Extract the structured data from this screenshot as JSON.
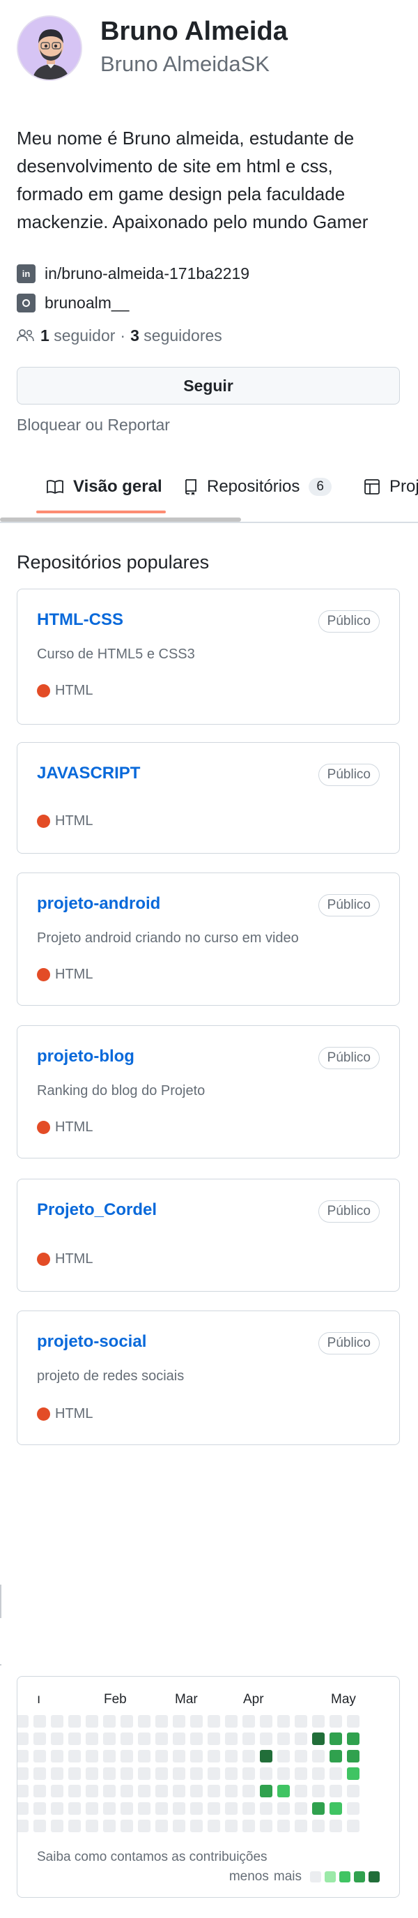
{
  "profile": {
    "name": "Bruno Almeida",
    "login": "Bruno AlmeidaSK",
    "bio_lines": [
      "Meu nome é Bruno almeida, estudante de",
      "desenvolvimento de site em html e css,",
      "formado em game design pela faculdade",
      "mackenzie. Apaixonado pelo mundo Gamer"
    ],
    "linkedin_icon": "in",
    "linkedin": "in/bruno-almeida-171ba2219",
    "instagram": "brunoalm__"
  },
  "followers": {
    "followers_count": "1",
    "followers_label": "seguidor",
    "separator": "·",
    "following_count": "3",
    "following_label": "seguidores"
  },
  "actions": {
    "follow_label": "Seguir",
    "block_label": "Bloquear ou Reportar"
  },
  "tabs": [
    {
      "label": "Visão geral",
      "icon": "book-icon"
    },
    {
      "label": "Repositórios",
      "count": "6",
      "icon": "repo-icon"
    },
    {
      "label": "Projetos",
      "icon": "table-icon"
    }
  ],
  "popular": {
    "title": "Repositórios populares",
    "repos": [
      {
        "name": "HTML-CSS",
        "visibility": "Público",
        "description": "Curso de HTML5 e CSS3",
        "language": "HTML"
      },
      {
        "name": "JAVASCRIPT",
        "visibility": "Público",
        "description": "",
        "language": "HTML"
      },
      {
        "name": "projeto-android",
        "visibility": "Público",
        "description": "Projeto android criando no curso em video",
        "language": "HTML"
      },
      {
        "name": "projeto-blog",
        "visibility": "Público",
        "description": "Ranking do blog do Projeto",
        "language": "HTML"
      },
      {
        "name": "Projeto_Cordel",
        "visibility": "Público",
        "description": "",
        "language": "HTML"
      },
      {
        "name": "projeto-social",
        "visibility": "Público",
        "description": "projeto de redes sociais",
        "language": "HTML"
      }
    ]
  },
  "contributions": {
    "months": [
      "Feb",
      "Mar",
      "Apr",
      "May"
    ],
    "link_label": "Saiba como contamos as contribuições",
    "legend_less": "menos",
    "legend_more": "mais",
    "legend_colors": [
      "#ebedf0",
      "#9be9a8",
      "#40c463",
      "#30a14e",
      "#216e39"
    ],
    "levels": [
      [
        0,
        0,
        0,
        0,
        0,
        0,
        0
      ],
      [
        0,
        0,
        0,
        0,
        0,
        0,
        0
      ],
      [
        0,
        0,
        0,
        0,
        0,
        0,
        0
      ],
      [
        0,
        0,
        0,
        0,
        0,
        0,
        0
      ],
      [
        0,
        0,
        0,
        0,
        0,
        0,
        0
      ],
      [
        0,
        0,
        0,
        0,
        0,
        0,
        0
      ],
      [
        0,
        0,
        0,
        0,
        0,
        0,
        0
      ],
      [
        0,
        0,
        0,
        0,
        0,
        0,
        0
      ],
      [
        0,
        0,
        0,
        0,
        0,
        0,
        0
      ],
      [
        0,
        0,
        0,
        0,
        0,
        0,
        0
      ],
      [
        0,
        0,
        0,
        0,
        0,
        0,
        0
      ],
      [
        0,
        0,
        0,
        0,
        0,
        0,
        0
      ],
      [
        0,
        0,
        0,
        0,
        0,
        0,
        0
      ],
      [
        0,
        0,
        0,
        0,
        0,
        0,
        0
      ],
      [
        0,
        0,
        0,
        0,
        0,
        0,
        0
      ],
      [
        0,
        0,
        0,
        0,
        0,
        0,
        0
      ],
      [
        0,
        0,
        0,
        0,
        0,
        0,
        0
      ],
      [
        0,
        0,
        0,
        0,
        0,
        0,
        0
      ],
      [
        0,
        0,
        0,
        0,
        0,
        0,
        0
      ],
      [
        0,
        0,
        0,
        0,
        0,
        0,
        0
      ],
      [
        0,
        0,
        0,
        0,
        0,
        0,
        0
      ],
      [
        0,
        0,
        0,
        0,
        0,
        0,
        0
      ],
      [
        0,
        0,
        0,
        0,
        0,
        0,
        0
      ],
      [
        0,
        0,
        0,
        0,
        0,
        0,
        0
      ],
      [
        0,
        0,
        0,
        0,
        0,
        0,
        0
      ],
      [
        0,
        0,
        0,
        0,
        0,
        0,
        0
      ],
      [
        0,
        0,
        4,
        0,
        3,
        0,
        0
      ],
      [
        0,
        0,
        0,
        0,
        2,
        0,
        0
      ],
      [
        0,
        0,
        0,
        0,
        0,
        0,
        0
      ],
      [
        0,
        4,
        0,
        0,
        0,
        3,
        0
      ],
      [
        0,
        3,
        3,
        0,
        0,
        2,
        0
      ],
      [
        0,
        3,
        3,
        2,
        0,
        0,
        0
      ]
    ]
  }
}
